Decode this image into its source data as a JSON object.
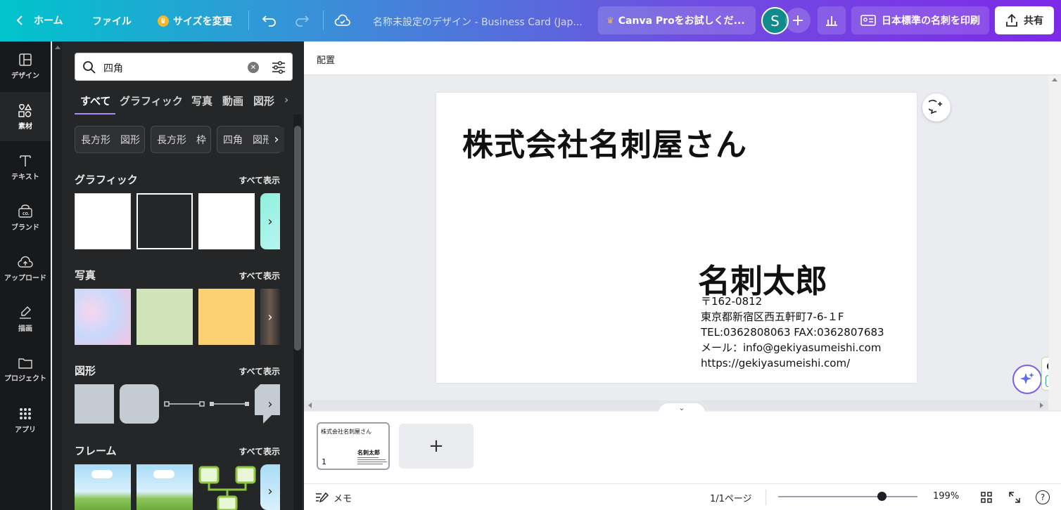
{
  "topbar": {
    "home_label": "ホーム",
    "file_label": "ファイル",
    "resize_label": "サイズを変更",
    "doc_title": "名称未設定のデザイン - Business Card (Jap...",
    "pro_label": "Canva Proをお試しくだ...",
    "avatar_letter": "S",
    "print_label": "日本標準の名刺を印刷",
    "share_label": "共有"
  },
  "rail": {
    "items": [
      {
        "label": "デザイン"
      },
      {
        "label": "素材"
      },
      {
        "label": "テキスト"
      },
      {
        "label": "ブランド"
      },
      {
        "label": "アップロード"
      },
      {
        "label": "描画"
      },
      {
        "label": "プロジェクト"
      },
      {
        "label": "アプリ"
      }
    ]
  },
  "panel": {
    "search_value": "四角",
    "tabs": [
      "すべて",
      "グラフィック",
      "写真",
      "動画",
      "図形"
    ],
    "chips": [
      "長方形　図形",
      "長方形　枠",
      "四角　図形"
    ],
    "sections": {
      "graphics": {
        "title": "グラフィック",
        "link": "すべて表示"
      },
      "photos": {
        "title": "写真",
        "link": "すべて表示"
      },
      "shapes": {
        "title": "図形",
        "link": "すべて表示"
      },
      "frames": {
        "title": "フレーム",
        "link": "すべて表示"
      }
    }
  },
  "editor": {
    "context_label": "配置",
    "card": {
      "company": "株式会社名刺屋さん",
      "name": "名刺太郎",
      "lines": [
        "〒162-0812",
        "東京都新宿区西五軒町7-6-１F",
        "TEL:0362808063 FAX:0362807683",
        "メール：info@gekiyasumeishi.com",
        "https://gekiyasumeishi.com/"
      ]
    }
  },
  "pages": {
    "thumb_company": "株式会社名刺屋さん",
    "thumb_name": "名刺太郎",
    "thumb_number": "1"
  },
  "footer": {
    "notes_label": "メモ",
    "page_count": "1/1ページ",
    "zoom": "199%",
    "zoom_level_fraction": 0.74
  },
  "colors": {
    "accent": "#7d2ae8",
    "teal": "#00c4cc",
    "panel_bg": "#252627",
    "rail_bg": "#18191b"
  }
}
